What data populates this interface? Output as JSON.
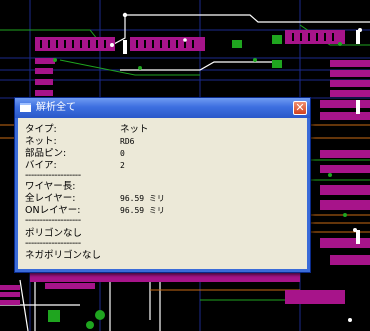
{
  "dialog": {
    "title": "解析全て",
    "close_label": "✕",
    "rows": {
      "type_label": "タイプ:",
      "type_value": "ネット",
      "net_label": "ネット:",
      "net_value": "RD6",
      "pin_label": "部品ピン:",
      "pin_value": "0",
      "via_label": "バイア:",
      "via_value": "2",
      "separator": "-------------------",
      "wire_length_label": "ワイヤー長:",
      "all_layer_label": "全レイヤー:",
      "all_layer_value": "96.59 ミリ",
      "on_layer_label": "ONレイヤー:",
      "on_layer_value": "96.59 ミリ",
      "polygon_label": "ポリゴンなし",
      "nega_polygon_label": "ネガポリゴンなし"
    }
  },
  "colors": {
    "pcb_background": "#000000",
    "pad_magenta": "#a7148a",
    "pad_green": "#1fa51f",
    "trace_white": "#ffffff",
    "trace_orange": "#c86a14",
    "grid_blue": "#1b2a8c"
  }
}
